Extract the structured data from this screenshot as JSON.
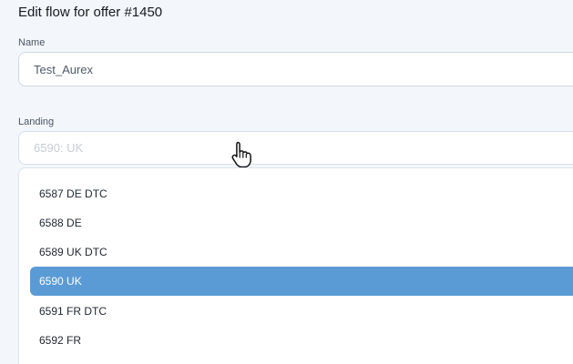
{
  "header": {
    "title": "Edit flow for offer #1450"
  },
  "form": {
    "name_label": "Name",
    "name_value": "Test_Aurex",
    "landing_label": "Landing",
    "landing_placeholder": "6590: UK"
  },
  "dropdown": {
    "options": [
      {
        "label": "6587 DE DTC",
        "selected": false
      },
      {
        "label": "6588 DE",
        "selected": false
      },
      {
        "label": "6589 UK DTC",
        "selected": false
      },
      {
        "label": "6590 UK",
        "selected": true
      },
      {
        "label": "6591 FR DTC",
        "selected": false
      },
      {
        "label": "6592 FR",
        "selected": false
      }
    ]
  },
  "cursor": {
    "icon": "hand-pointer-icon"
  },
  "colors": {
    "page_background": "#f3f7fb",
    "selected_option_background": "#5b9bd5",
    "selected_option_text": "#ffffff",
    "input_border": "#cfd7e3"
  }
}
